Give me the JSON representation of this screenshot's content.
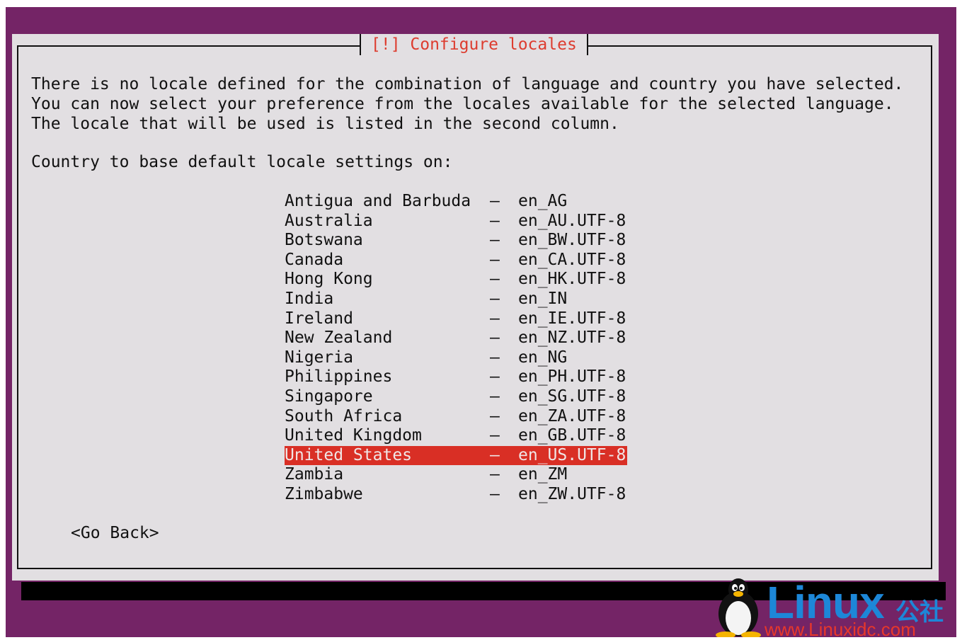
{
  "dialog": {
    "title": "[!] Configure locales",
    "description_lines": [
      "There is no locale defined for the combination of language and country you have selected.",
      "You can now select your preference from the locales available for the selected language.",
      "The locale that will be used is listed in the second column."
    ],
    "prompt": "Country to base default locale settings on:",
    "separator": "–",
    "locales": [
      {
        "country": "Antigua and Barbuda",
        "locale": "en_AG"
      },
      {
        "country": "Australia",
        "locale": "en_AU.UTF-8"
      },
      {
        "country": "Botswana",
        "locale": "en_BW.UTF-8"
      },
      {
        "country": "Canada",
        "locale": "en_CA.UTF-8"
      },
      {
        "country": "Hong Kong",
        "locale": "en_HK.UTF-8"
      },
      {
        "country": "India",
        "locale": "en_IN"
      },
      {
        "country": "Ireland",
        "locale": "en_IE.UTF-8"
      },
      {
        "country": "New Zealand",
        "locale": "en_NZ.UTF-8"
      },
      {
        "country": "Nigeria",
        "locale": "en_NG"
      },
      {
        "country": "Philippines",
        "locale": "en_PH.UTF-8"
      },
      {
        "country": "Singapore",
        "locale": "en_SG.UTF-8"
      },
      {
        "country": "South Africa",
        "locale": "en_ZA.UTF-8"
      },
      {
        "country": "United Kingdom",
        "locale": "en_GB.UTF-8"
      },
      {
        "country": "United States",
        "locale": "en_US.UTF-8",
        "selected": true
      },
      {
        "country": "Zambia",
        "locale": "en_ZM"
      },
      {
        "country": "Zimbabwe",
        "locale": "en_ZW.UTF-8"
      }
    ],
    "go_back_label": "<Go Back>"
  },
  "watermark": {
    "brand": "Linux",
    "suffix": "公社",
    "url": "www.Linuxidc.com"
  },
  "colors": {
    "background": "#742466",
    "dialog": "#e2dfe2",
    "highlight": "#d92f25",
    "title": "#dd3c2f"
  }
}
